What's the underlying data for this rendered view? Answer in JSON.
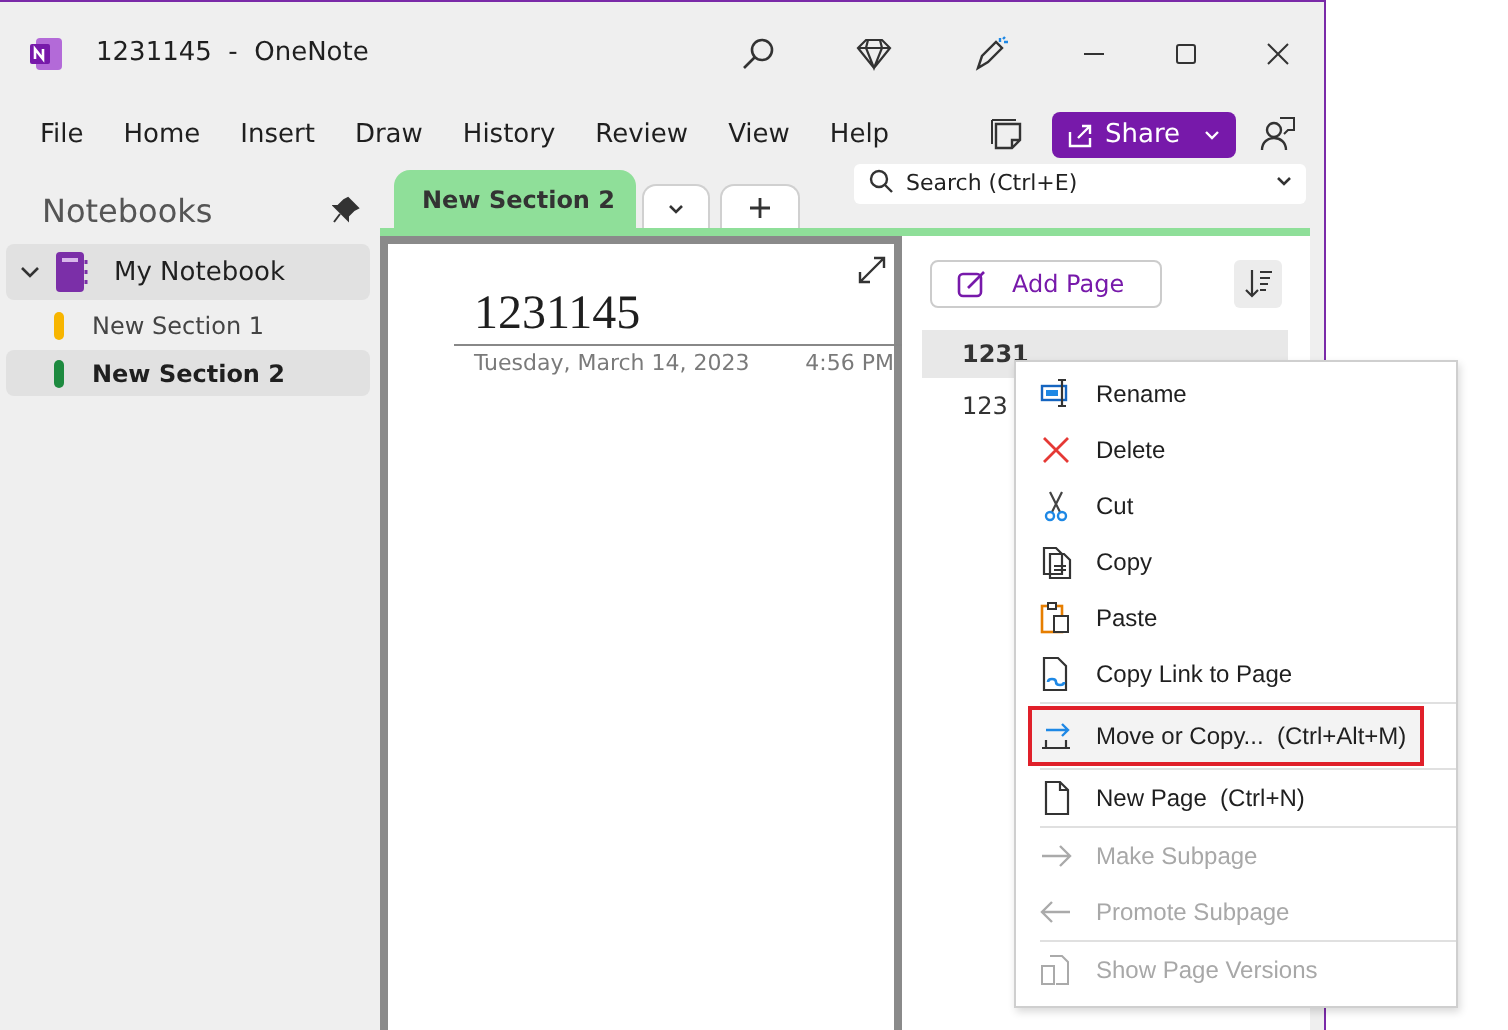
{
  "window": {
    "title": "1231145  -  OneNote"
  },
  "menu": [
    {
      "label": "File"
    },
    {
      "label": "Home"
    },
    {
      "label": "Insert"
    },
    {
      "label": "Draw"
    },
    {
      "label": "History"
    },
    {
      "label": "Review"
    },
    {
      "label": "View"
    },
    {
      "label": "Help"
    }
  ],
  "share_button": {
    "label": "Share"
  },
  "notebooks_pane": {
    "title": "Notebooks",
    "notebook": {
      "name": "My Notebook",
      "expanded": true
    },
    "sections": [
      {
        "name": "New Section 1",
        "color": "#f7b500",
        "selected": false
      },
      {
        "name": "New Section 2",
        "color": "#1d8a3f",
        "selected": true
      }
    ]
  },
  "section_tabs": [
    {
      "label": "New Section 2",
      "selected": true
    }
  ],
  "search": {
    "placeholder": "Search (Ctrl+E)"
  },
  "page": {
    "title": "1231145",
    "date": "Tuesday, March 14, 2023",
    "time": "4:56 PM"
  },
  "page_list": {
    "add_label": "Add Page",
    "pages": [
      {
        "title": "1231",
        "selected": true
      },
      {
        "title": "123",
        "selected": false
      }
    ]
  },
  "context_menu": {
    "groups": [
      [
        {
          "label": "Rename",
          "disabled": false,
          "selected": false
        },
        {
          "label": "Delete",
          "disabled": false,
          "selected": false
        },
        {
          "label": "Cut",
          "disabled": false,
          "selected": false
        },
        {
          "label": "Copy",
          "disabled": false,
          "selected": false
        },
        {
          "label": "Paste",
          "disabled": false,
          "selected": false
        },
        {
          "label": "Copy Link to Page",
          "disabled": false,
          "selected": false
        }
      ],
      [
        {
          "label": "Move or Copy...",
          "shortcut": "(Ctrl+Alt+M)",
          "disabled": false,
          "selected": true
        }
      ],
      [
        {
          "label": "New Page",
          "shortcut": "(Ctrl+N)",
          "disabled": false,
          "selected": false
        }
      ],
      [
        {
          "label": "Make Subpage",
          "disabled": true,
          "selected": false
        },
        {
          "label": "Promote Subpage",
          "disabled": true,
          "selected": false
        }
      ],
      [
        {
          "label": "Show Page Versions",
          "disabled": true,
          "selected": false
        }
      ]
    ]
  }
}
